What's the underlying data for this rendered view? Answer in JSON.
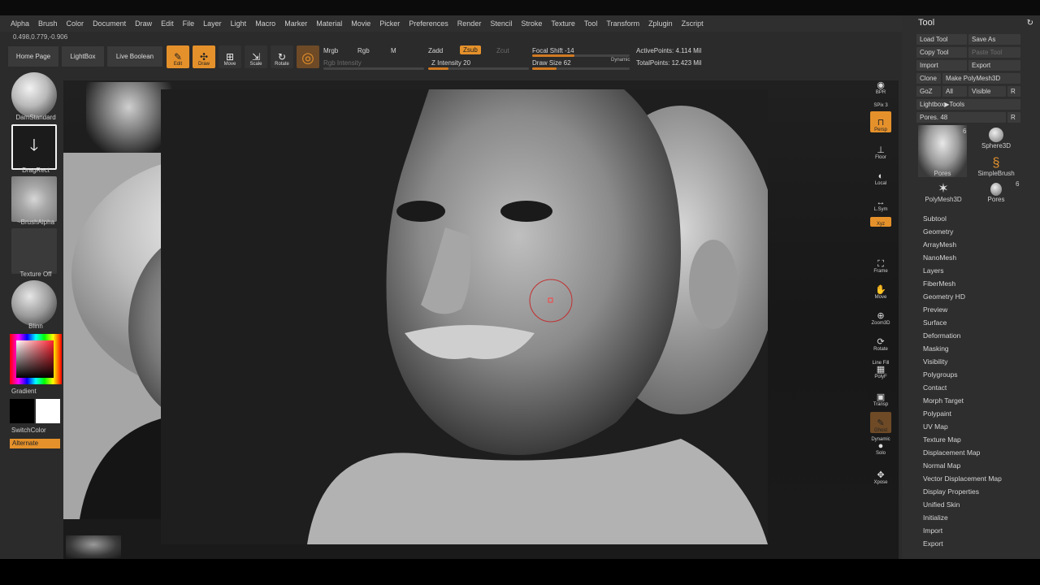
{
  "menu": [
    "Alpha",
    "Brush",
    "Color",
    "Document",
    "Draw",
    "Edit",
    "File",
    "Layer",
    "Light",
    "Macro",
    "Marker",
    "Material",
    "Movie",
    "Picker",
    "Preferences",
    "Render",
    "Stencil",
    "Stroke",
    "Texture",
    "Tool",
    "Transform",
    "Zplugin",
    "Zscript"
  ],
  "coords": "0.498,0.779,-0.906",
  "shelf": {
    "home_page": "Home Page",
    "lightbox": "LightBox",
    "live_boolean": "Live Boolean",
    "edit": "Edit",
    "draw": "Draw",
    "move": "Move",
    "scale": "Scale",
    "rotate": "Rotate",
    "mrgb": "Mrgb",
    "rgb": "Rgb",
    "m": "M",
    "rgb_intensity": "Rgb Intensity",
    "zadd": "Zadd",
    "zsub": "Zsub",
    "zcut": "Zcut",
    "z_intensity": "Z Intensity 20",
    "z_intensity_value": 20,
    "focal_shift": "Focal Shift -14",
    "focal_shift_value": -14,
    "draw_size": "Draw Size 62",
    "draw_size_value": 62,
    "dynamic": "Dynamic",
    "active_points": "ActivePoints: 4.114 Mil",
    "total_points": "TotalPoints: 12.423 Mil"
  },
  "left_tray": {
    "brush": "DamStandard",
    "stroke": "DragRect",
    "alpha": "~BrushAlpha",
    "texture": "Texture Off",
    "material": "Blinn",
    "gradient": "Gradient",
    "switch_color": "SwitchColor",
    "alternate": "Alternate"
  },
  "right_strip": [
    "BPR",
    "SPix 3",
    "Persp",
    "Floor",
    "Local",
    "L.Sym",
    "Xyz",
    "Frame",
    "Move",
    "Zoom3D",
    "Rotate",
    "Line Fill",
    "PolyF",
    "Transp",
    "Ghost",
    "Dynamic",
    "Solo",
    "Xpose"
  ],
  "tool_panel": {
    "title": "Tool",
    "load_tool": "Load Tool",
    "save_as": "Save As",
    "copy_tool": "Copy Tool",
    "paste_tool": "Paste Tool",
    "import": "Import",
    "export": "Export",
    "clone": "Clone",
    "make_polymesh": "Make PolyMesh3D",
    "goz": "GoZ",
    "all": "All",
    "visible": "Visible",
    "r": "R",
    "lightbox_tools": "Lightbox▶Tools",
    "pores_slider": "Pores. 48",
    "pores_slider_value": 48,
    "thumbs": [
      {
        "name": "Pores",
        "count": "6"
      },
      {
        "name": "Sphere3D",
        "count": ""
      },
      {
        "name": "SimpleBrush",
        "count": ""
      },
      {
        "name": "PolyMesh3D",
        "count": ""
      },
      {
        "name": "Pores",
        "count": "6"
      }
    ],
    "subpalettes": [
      "Subtool",
      "Geometry",
      "ArrayMesh",
      "NanoMesh",
      "Layers",
      "FiberMesh",
      "Geometry HD",
      "Preview",
      "Surface",
      "Deformation",
      "Masking",
      "Visibility",
      "Polygroups",
      "Contact",
      "Morph Target",
      "Polypaint",
      "UV Map",
      "Texture Map",
      "Displacement Map",
      "Normal Map",
      "Vector Displacement Map",
      "Display Properties",
      "Unified Skin",
      "Initialize",
      "Import",
      "Export"
    ]
  },
  "colors": {
    "accent": "#e5912b",
    "panel": "#2e2e2e",
    "canvas": "#151515"
  }
}
